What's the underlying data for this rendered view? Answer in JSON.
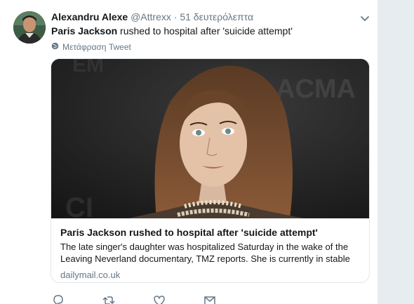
{
  "tweet": {
    "user": {
      "fullname": "Alexandru Alexe",
      "handle": "@Attrexx",
      "separator": "·",
      "timestamp": "51 δευτερόλεπτα"
    },
    "text_bold": "Paris Jackson",
    "text_rest": " rushed to hospital after 'suicide attempt'",
    "translate_label": "Μετάφραση Tweet",
    "card": {
      "title": "Paris Jackson rushed to hospital after 'suicide attempt'",
      "description": "The late singer's daughter was hospitalized Saturday in the wake of the Leaving Neverland documentary, TMZ reports. She is currently in stable",
      "domain": "dailymail.co.uk"
    }
  },
  "icons": {
    "caret": "chevron-down-icon",
    "translate": "globe-icon",
    "reply": "reply-icon",
    "retweet": "retweet-icon",
    "like": "heart-icon",
    "dm": "envelope-icon"
  },
  "colors": {
    "text": "#14171a",
    "secondary": "#657786",
    "border": "#e1e8ed",
    "background": "#e6ecf0"
  }
}
